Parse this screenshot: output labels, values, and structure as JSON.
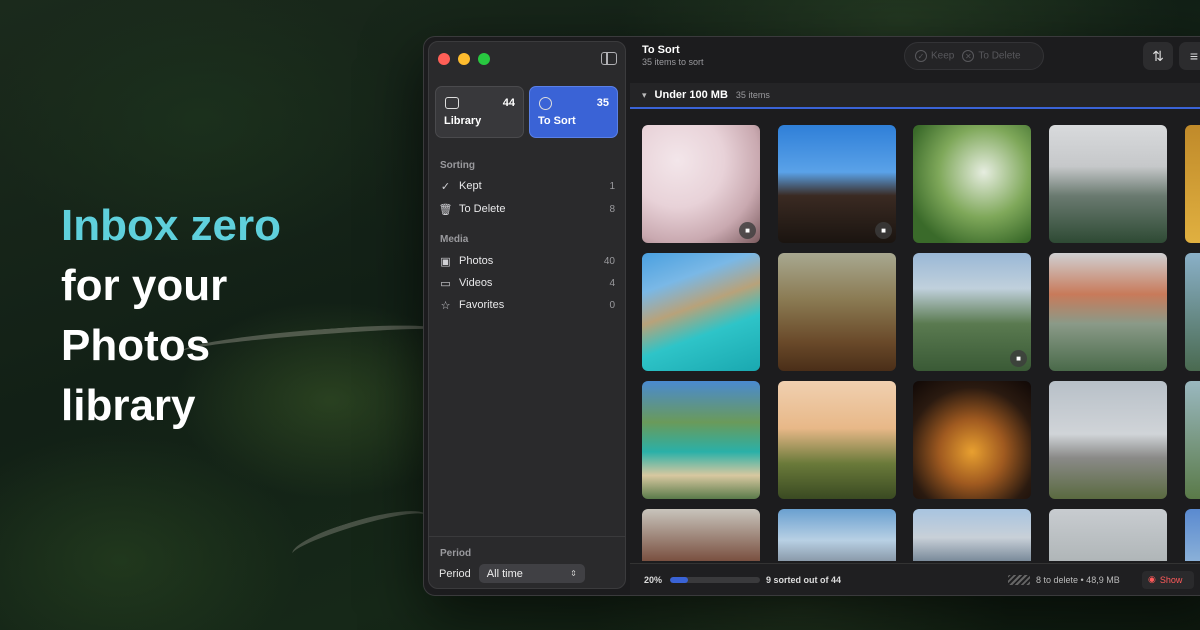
{
  "headline": {
    "accent": "Inbox zero",
    "line2": "for your",
    "line3": "Photos",
    "line4": "library"
  },
  "sidebar": {
    "tiles": [
      {
        "label": "Library",
        "count": "44"
      },
      {
        "label": "To Sort",
        "count": "35"
      }
    ],
    "sorting_title": "Sorting",
    "sorting_items": [
      {
        "label": "Kept",
        "count": "1",
        "icon": "check-circle-icon"
      },
      {
        "label": "To Delete",
        "count": "8",
        "icon": "trash-icon"
      }
    ],
    "media_title": "Media",
    "media_items": [
      {
        "label": "Photos",
        "count": "40",
        "icon": "photo-icon"
      },
      {
        "label": "Videos",
        "count": "4",
        "icon": "video-icon"
      },
      {
        "label": "Favorites",
        "count": "0",
        "icon": "star-icon"
      }
    ],
    "period_section": "Period",
    "period_label": "Period",
    "period_value": "All time"
  },
  "main": {
    "title": "To Sort",
    "subtitle": "35 items to sort",
    "keep_label": "Keep",
    "delete_label": "To Delete",
    "group_title": "Under 100 MB",
    "group_count": "35 items"
  },
  "footer": {
    "percent": "20%",
    "progress": 0.2,
    "sorted_text": "9 sorted out of 44",
    "delete_text": "8 to delete • 48,9 MB",
    "show_label": "Show"
  },
  "colors": {
    "accent": "#3a63d6",
    "headline_accent": "#5fd0dc",
    "danger": "#ff5a5a"
  }
}
